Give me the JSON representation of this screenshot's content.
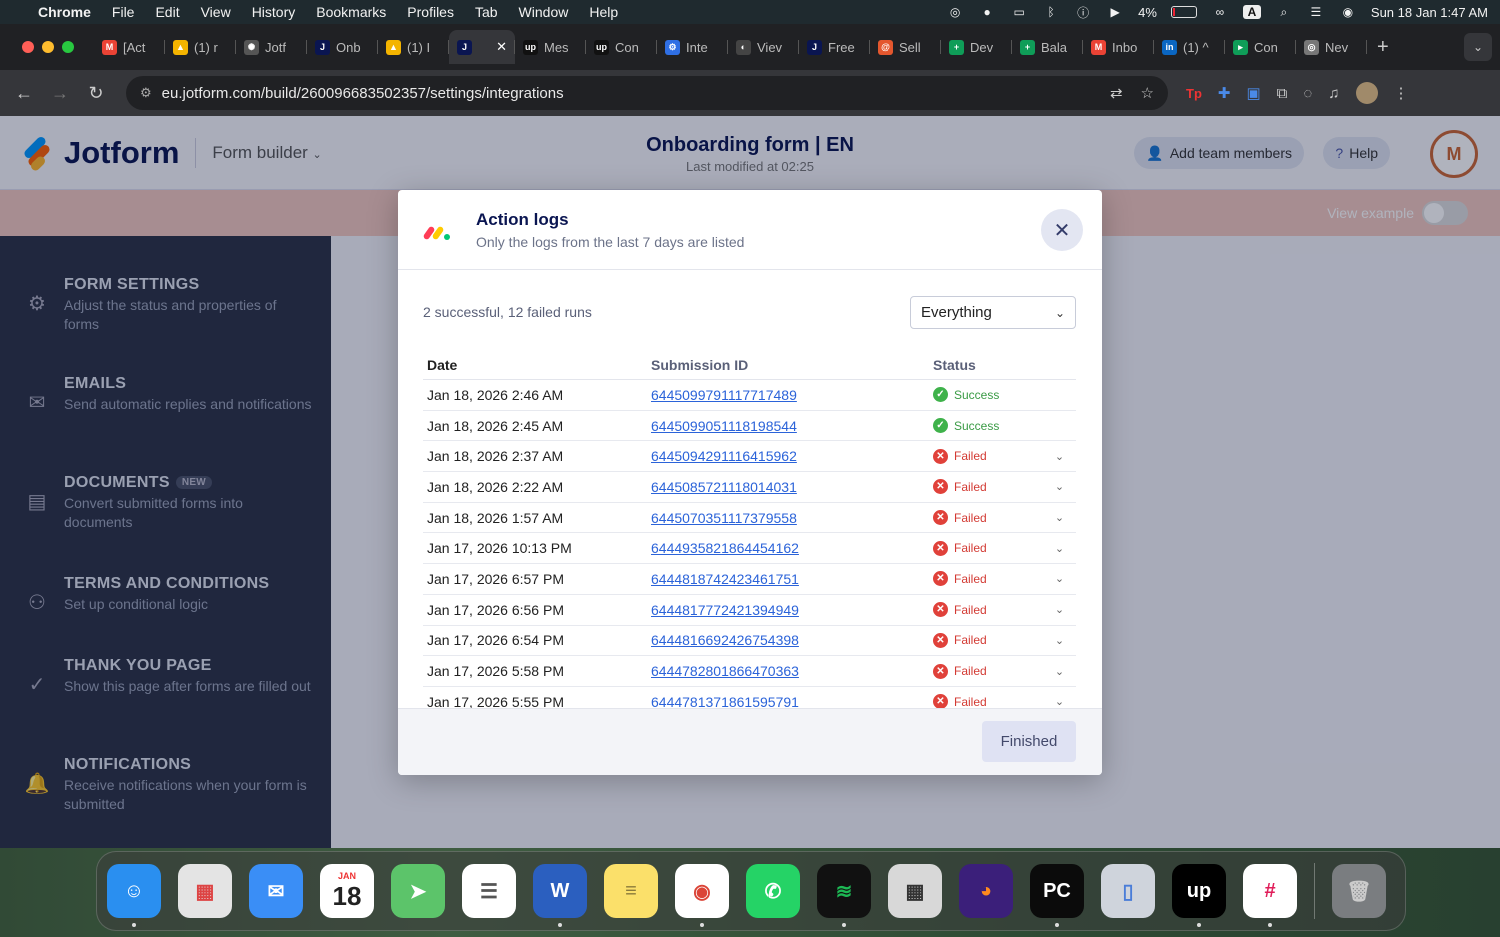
{
  "menubar": {
    "app": "Chrome",
    "items": [
      "File",
      "Edit",
      "View",
      "History",
      "Bookmarks",
      "Profiles",
      "Tab",
      "Window",
      "Help"
    ],
    "battery": "4%",
    "input_source": "A",
    "datetime": "Sun 18 Jan  1:47 AM"
  },
  "tabs": [
    {
      "label": "[Act",
      "icon": "gmail-icon",
      "color": "#ea4335",
      "glyph": "M"
    },
    {
      "label": "(1) r",
      "icon": "drive-icon",
      "color": "#f4b400",
      "glyph": "▲"
    },
    {
      "label": "Jotf",
      "icon": "chatgpt-icon",
      "color": "#555555",
      "glyph": "✺"
    },
    {
      "label": "Onb",
      "icon": "jotform-icon",
      "color": "#0a1551",
      "glyph": "J"
    },
    {
      "label": "(1) I",
      "icon": "drive-icon",
      "color": "#f4b400",
      "glyph": "▲"
    },
    {
      "label": "",
      "icon": "jotform-icon",
      "color": "#0a1551",
      "glyph": "J",
      "active": true
    },
    {
      "label": "Mes",
      "icon": "upwork-icon",
      "color": "#111111",
      "glyph": "up"
    },
    {
      "label": "Con",
      "icon": "upwork-icon",
      "color": "#111111",
      "glyph": "up"
    },
    {
      "label": "Inte",
      "icon": "settings-icon",
      "color": "#2f6fe4",
      "glyph": "⚙"
    },
    {
      "label": "Viev",
      "icon": "page-icon",
      "color": "#444444",
      "glyph": "◐"
    },
    {
      "label": "Free",
      "icon": "jotform-icon",
      "color": "#0a1551",
      "glyph": "J"
    },
    {
      "label": "Sell",
      "icon": "swirl-icon",
      "color": "#e4572e",
      "glyph": "@"
    },
    {
      "label": "Dev",
      "icon": "sheets-icon",
      "color": "#0f9d58",
      "glyph": "+"
    },
    {
      "label": "Bala",
      "icon": "sheets-icon",
      "color": "#0f9d58",
      "glyph": "+"
    },
    {
      "label": "Inbo",
      "icon": "gmail-icon",
      "color": "#ea4335",
      "glyph": "M"
    },
    {
      "label": "(1) ^",
      "icon": "linkedin-icon",
      "color": "#0a66c2",
      "glyph": "in"
    },
    {
      "label": "Con",
      "icon": "docs-icon",
      "color": "#0f9d58",
      "glyph": "▸"
    },
    {
      "label": "Nev",
      "icon": "chrome-icon",
      "color": "#777777",
      "glyph": "◎"
    }
  ],
  "address": {
    "url": "eu.jotform.com/build/260096683502357/settings/integrations"
  },
  "header": {
    "logo": "Jotform",
    "builder": "Form builder",
    "form_title": "Onboarding form | EN",
    "last_modified": "Last modified at 02:25",
    "add_team": "Add team members",
    "help": "Help",
    "avatar": "M"
  },
  "banner": {
    "view_example": "View example"
  },
  "sidebar": [
    {
      "title": "FORM SETTINGS",
      "desc": "Adjust the status and properties of forms",
      "icon": "gear-icon",
      "glyph": "⚙"
    },
    {
      "title": "EMAILS",
      "desc": "Send automatic replies and notifications",
      "icon": "mail-icon",
      "glyph": "✉"
    },
    {
      "title": "DOCUMENTS",
      "badge": "NEW",
      "desc": "Convert submitted forms into documents",
      "icon": "document-icon",
      "glyph": "▤"
    },
    {
      "title": "TERMS AND CONDITIONS",
      "desc": "Set up conditional logic",
      "icon": "hierarchy-icon",
      "glyph": "⚇"
    },
    {
      "title": "THANK YOU PAGE",
      "desc": "Show this page after forms are filled out",
      "icon": "check-circle-icon",
      "glyph": "✓"
    },
    {
      "title": "NOTIFICATIONS",
      "desc": "Receive notifications when your form is submitted",
      "icon": "bell-icon",
      "glyph": "🔔"
    }
  ],
  "modal": {
    "title": "Action logs",
    "subtitle": "Only the logs from the last 7 days are listed",
    "summary": "2 successful, 12 failed runs",
    "filter": "Everything",
    "columns": {
      "date": "Date",
      "submission_id": "Submission ID",
      "status": "Status"
    },
    "rows": [
      {
        "date": "Jan 18, 2026 2:46 AM",
        "id": "6445099791117717489",
        "status": "Success"
      },
      {
        "date": "Jan 18, 2026 2:45 AM",
        "id": "6445099051118198544",
        "status": "Success"
      },
      {
        "date": "Jan 18, 2026 2:37 AM",
        "id": "6445094291116415962",
        "status": "Failed"
      },
      {
        "date": "Jan 18, 2026 2:22 AM",
        "id": "6445085721118014031",
        "status": "Failed"
      },
      {
        "date": "Jan 18, 2026 1:57 AM",
        "id": "6445070351117379558",
        "status": "Failed"
      },
      {
        "date": "Jan 17, 2026 10:13 PM",
        "id": "6444935821864454162",
        "status": "Failed"
      },
      {
        "date": "Jan 17, 2026 6:57 PM",
        "id": "6444818742423461751",
        "status": "Failed"
      },
      {
        "date": "Jan 17, 2026 6:56 PM",
        "id": "6444817772421394949",
        "status": "Failed"
      },
      {
        "date": "Jan 17, 2026 6:54 PM",
        "id": "6444816692426754398",
        "status": "Failed"
      },
      {
        "date": "Jan 17, 2026 5:58 PM",
        "id": "6444782801866470363",
        "status": "Failed"
      },
      {
        "date": "Jan 17, 2026 5:55 PM",
        "id": "6444781371861595791",
        "status": "Failed"
      }
    ],
    "finished": "Finished"
  },
  "dock": [
    {
      "name": "finder",
      "bg": "#2a8ff0",
      "glyph": "☺",
      "running": true
    },
    {
      "name": "launchpad",
      "bg": "#e4e4e4",
      "glyph": "▦",
      "fg": "#d44"
    },
    {
      "name": "mail",
      "bg": "#3a8ef6",
      "glyph": "✉"
    },
    {
      "name": "calendar",
      "bg": "#ffffff",
      "glyph": "18",
      "label": "JAN",
      "fg": "#222"
    },
    {
      "name": "maps",
      "bg": "#5cc46a",
      "glyph": "➤"
    },
    {
      "name": "reminders",
      "bg": "#ffffff",
      "glyph": "☰",
      "fg": "#555"
    },
    {
      "name": "word",
      "bg": "#2b5fbf",
      "glyph": "W",
      "running": true
    },
    {
      "name": "notes",
      "bg": "#fbe06a",
      "glyph": "≡",
      "fg": "#8a7a3a"
    },
    {
      "name": "chrome",
      "bg": "#ffffff",
      "glyph": "◉",
      "fg": "#db4437",
      "running": true
    },
    {
      "name": "whatsapp",
      "bg": "#25d366",
      "glyph": "✆"
    },
    {
      "name": "spotify",
      "bg": "#111111",
      "glyph": "≋",
      "fg": "#1db954",
      "running": true
    },
    {
      "name": "calculator",
      "bg": "#d8d8d8",
      "glyph": "▦",
      "fg": "#333"
    },
    {
      "name": "firefox",
      "bg": "#3b1f7a",
      "glyph": "◕",
      "fg": "#ff8a1f"
    },
    {
      "name": "pycharm",
      "bg": "#0b0b0b",
      "glyph": "PC",
      "fg": "#fff",
      "running": true
    },
    {
      "name": "simulator",
      "bg": "#cfd4dc",
      "glyph": "▯",
      "fg": "#4a7dd8"
    },
    {
      "name": "upwork",
      "bg": "#000000",
      "glyph": "up",
      "running": true
    },
    {
      "name": "slack",
      "bg": "#ffffff",
      "glyph": "#",
      "fg": "#e01e5a",
      "running": true
    },
    {
      "name": "trash",
      "bg": "#7a7d80",
      "glyph": "🗑",
      "fg": "#ccc"
    }
  ]
}
